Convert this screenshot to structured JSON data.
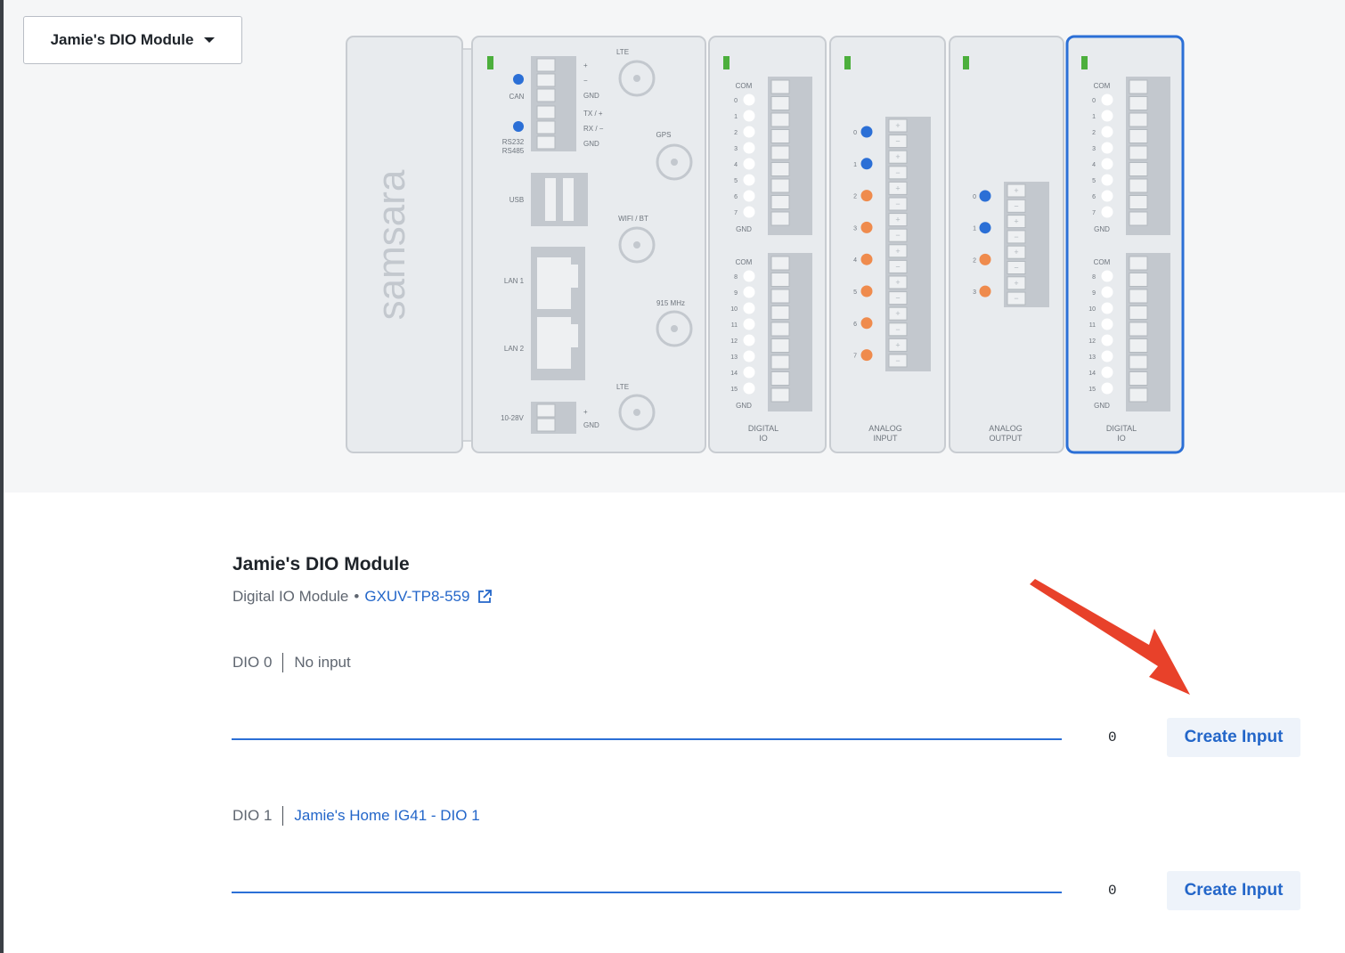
{
  "header": {
    "module_select": "Jamie's DIO Module"
  },
  "diagram": {
    "brand": "samsara",
    "gateway": {
      "can": "CAN",
      "rs": "RS232 RS485",
      "usb": "USB",
      "lan1": "LAN 1",
      "lan2": "LAN 2",
      "power": "10-28V",
      "plus": "+",
      "minus": "−",
      "gnd": "GND",
      "txp": "TX / +",
      "rxm": "RX / −",
      "lte": "LTE",
      "gps": "GPS",
      "wifi": "WIFI / BT",
      "mhz": "915 MHz"
    },
    "dio1": {
      "label1": "DIGITAL",
      "label2": "IO",
      "com": "COM",
      "gnd": "GND",
      "top_pins": [
        "0",
        "1",
        "2",
        "3",
        "4",
        "5",
        "6",
        "7"
      ],
      "bottom_pins": [
        "8",
        "9",
        "10",
        "11",
        "12",
        "13",
        "14",
        "15"
      ]
    },
    "ain": {
      "label1": "ANALOG",
      "label2": "INPUT",
      "pins": [
        "0",
        "1",
        "2",
        "3",
        "4",
        "5",
        "6",
        "7"
      ]
    },
    "aout": {
      "label1": "ANALOG",
      "label2": "OUTPUT",
      "pins": [
        "0",
        "1",
        "2",
        "3"
      ]
    },
    "dio2": {
      "label1": "DIGITAL",
      "label2": "IO"
    },
    "colors": {
      "blue": "#2b6fd6",
      "orange": "#ef8b4d",
      "green": "#4caf3c",
      "selected": "#2b6fd6"
    }
  },
  "detail": {
    "title": "Jamie's DIO Module",
    "type": "Digital IO Module",
    "bullet": "•",
    "serial": "GXUV-TP8-559"
  },
  "rows": [
    {
      "name": "DIO 0",
      "status": "No input",
      "value": "0",
      "button": "Create Input"
    },
    {
      "name": "DIO 1",
      "status": "Jamie's Home IG41 - DIO 1",
      "value": "0",
      "button": "Create Input"
    }
  ]
}
